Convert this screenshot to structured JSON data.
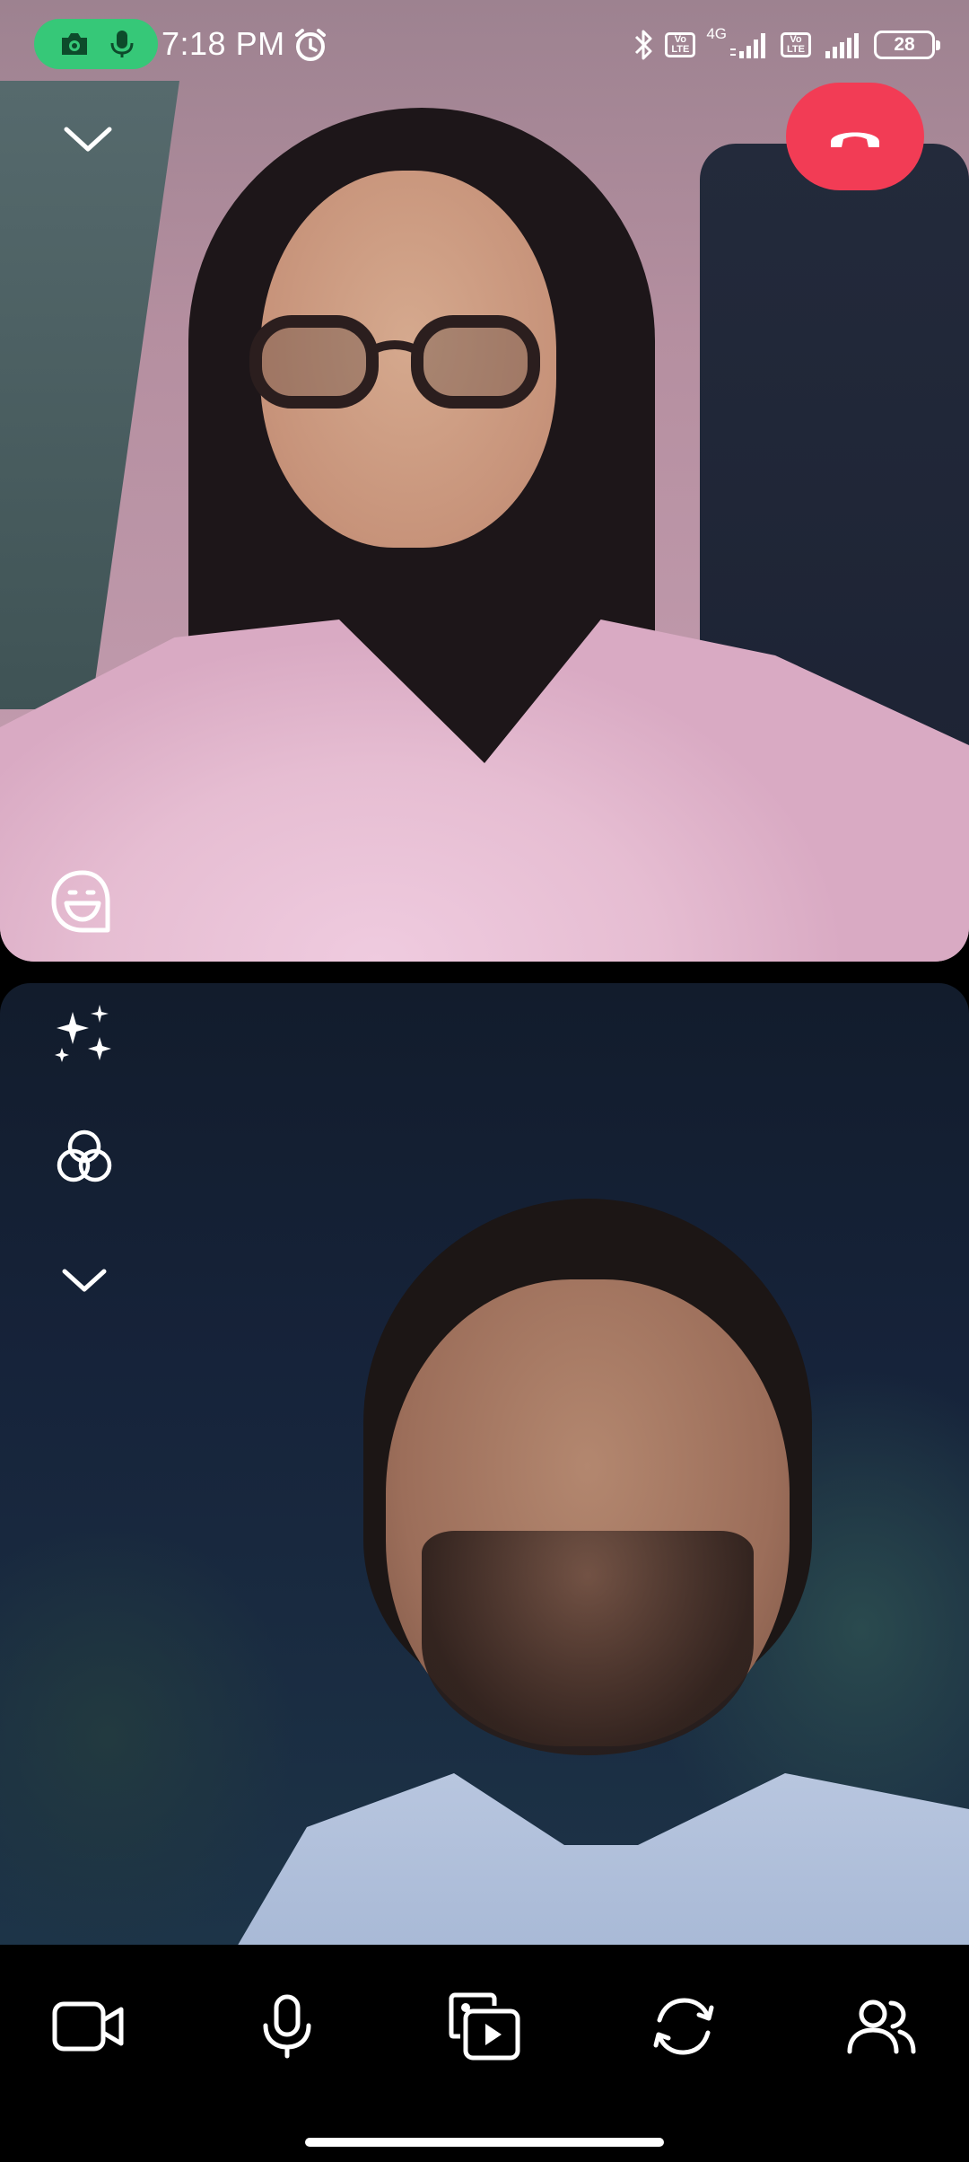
{
  "status_bar": {
    "time": "7:18 PM",
    "network_type": "4G",
    "volte_1": [
      "Vo",
      "LTE"
    ],
    "volte_2": [
      "Vo",
      "LTE"
    ],
    "battery": "28",
    "icons": [
      "camera-icon",
      "mic-icon",
      "alarm-icon",
      "bluetooth-icon",
      "signal-icon",
      "battery-icon"
    ]
  },
  "call": {
    "controls_top": [
      "chevron-down-icon",
      "end-call-icon"
    ],
    "remote_overlay": [
      "sticker-icon"
    ],
    "local_overlay": [
      "sparkles-icon",
      "lens-filter-icon",
      "chevron-down-icon"
    ]
  },
  "toolbar": {
    "items": [
      "video-camera-icon",
      "microphone-icon",
      "media-share-icon",
      "switch-camera-icon",
      "participants-icon"
    ]
  },
  "colors": {
    "end_call": "#f23c55",
    "recording_pill": "#36c878",
    "background": "#000000"
  }
}
